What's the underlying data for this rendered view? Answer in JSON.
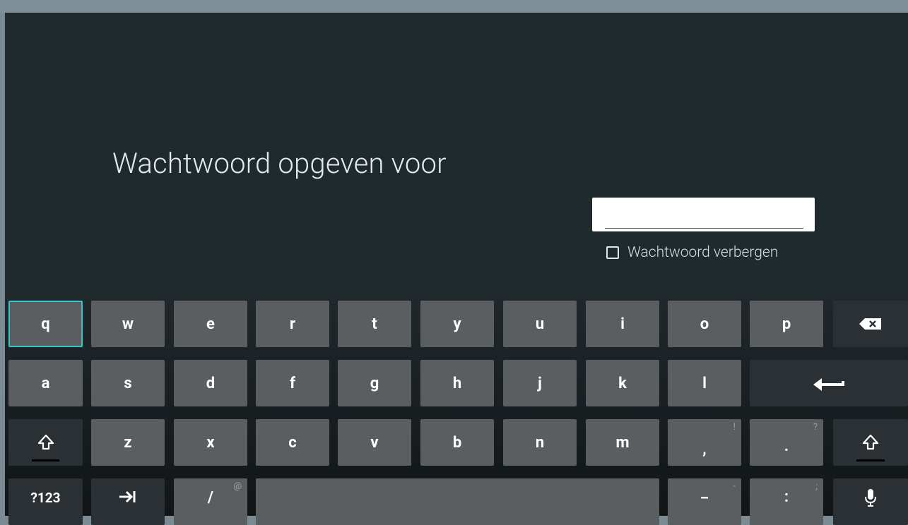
{
  "title": "Wachtwoord opgeven voor",
  "password_field": {
    "value": "",
    "placeholder": ""
  },
  "hide_password": {
    "label": "Wachtwoord verbergen",
    "checked": false
  },
  "keyboard": {
    "row1": [
      "q",
      "w",
      "e",
      "r",
      "t",
      "y",
      "u",
      "i",
      "o",
      "p"
    ],
    "row2": [
      "a",
      "s",
      "d",
      "f",
      "g",
      "h",
      "j",
      "k",
      "l"
    ],
    "row3": [
      "z",
      "x",
      "c",
      "v",
      "b",
      "n",
      "m"
    ],
    "comma": {
      "label": ",",
      "alt": "!"
    },
    "period": {
      "label": ".",
      "alt": "?"
    },
    "symbols_label": "?123",
    "slash": {
      "label": "/",
      "alt": "@"
    },
    "underscore": {
      "label": "_",
      "alt": "-"
    },
    "colon": {
      "label": ":",
      "alt": ";"
    },
    "icons": {
      "backspace": "backspace-icon",
      "enter": "enter-icon",
      "shift": "shift-icon",
      "tab": "tab-icon",
      "mic": "microphone-icon"
    }
  },
  "colors": {
    "focus_accent": "#35c6c8",
    "screen_bg": "#1f2a2e",
    "key_bg": "#5a5e60"
  }
}
